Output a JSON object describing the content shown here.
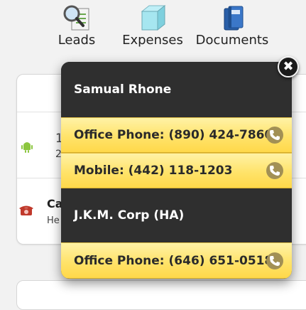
{
  "nav": {
    "items": [
      {
        "label": "Leads",
        "icon": "leads-magnifier-icon"
      },
      {
        "label": "Expenses",
        "icon": "expenses-cube-icon"
      },
      {
        "label": "Documents",
        "icon": "documents-binder-icon"
      }
    ]
  },
  "background_list": {
    "row1_fragment": "1",
    "row1_sub_fragment": "2",
    "row2_title_fragment": "Ca",
    "row2_sub_fragment": "He"
  },
  "popup": {
    "contacts": [
      {
        "name": "Samual Rhone",
        "phones": [
          {
            "label": "Office Phone: (890) 424-7860"
          },
          {
            "label": "Mobile: (442) 118-1203"
          }
        ]
      },
      {
        "name": "J.K.M. Corp (HA)",
        "phones": [
          {
            "label": "Office Phone: (646) 651-0518"
          }
        ]
      }
    ],
    "close_symbol": "✖"
  },
  "colors": {
    "popup_dark": "#2f2f2f",
    "popup_yellow": "#ffe36a",
    "phone_button": "#a29055",
    "android_green": "#8cc63f",
    "phone_red": "#c0392b"
  }
}
